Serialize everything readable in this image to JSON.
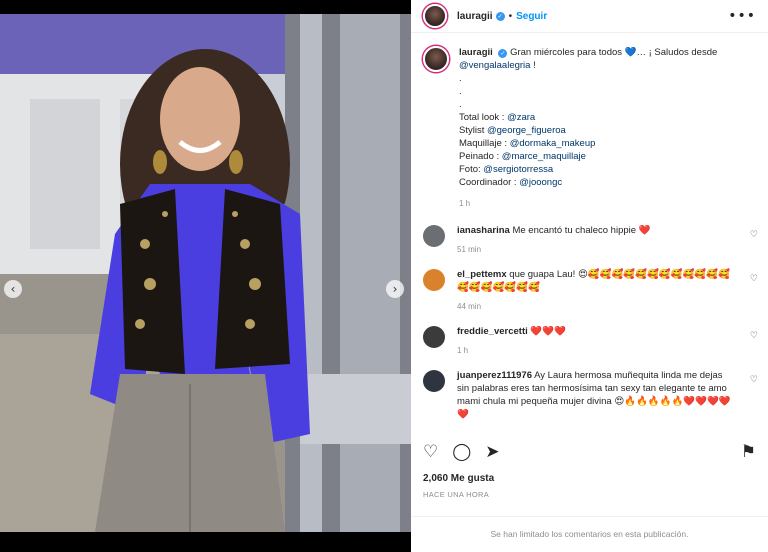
{
  "media": {
    "nav_prev_glyph": "‹",
    "nav_next_glyph": "›",
    "slide_count": 5,
    "active_slide": 3
  },
  "header": {
    "username": "lauragii",
    "verified_glyph": "✓",
    "separator": "•",
    "follow_label": "Seguir",
    "more_glyph": "•••"
  },
  "caption": {
    "username": "lauragii",
    "verified_glyph": "✓",
    "text_before_mention": "Gran miércoles para todos 💙… ¡ Saludos desde",
    "mention_main": "@vengalaalegria",
    "text_after_mention": " !",
    "dot_lines": [
      ".",
      ".",
      "."
    ],
    "credits": [
      {
        "label": "Total look : ",
        "handle": "@zara"
      },
      {
        "label": "Stylist ",
        "handle": "@george_figueroa"
      },
      {
        "label": "Maquillaje : ",
        "handle": "@dormaka_makeup"
      },
      {
        "label": "Peinado : ",
        "handle": "@marce_maquillaje"
      },
      {
        "label": "Foto: ",
        "handle": "@sergiotorressa"
      },
      {
        "label": "Coordinador : ",
        "handle": "@jooongc"
      }
    ],
    "time": "1 h"
  },
  "comments": [
    {
      "username": "ianasharina",
      "text": "Me encantó tu chaleco hippie ❤️",
      "time": "51 min",
      "avatar_color": "#6b6f73"
    },
    {
      "username": "el_pettemx",
      "text": "que guapa Lau! 😍🥰🥰🥰🥰🥰🥰🥰🥰🥰🥰🥰🥰🥰🥰🥰🥰🥰🥰🥰",
      "time": "44 min",
      "avatar_color": "#d9822b"
    },
    {
      "username": "freddie_vercetti",
      "text": "❤️❤️❤️",
      "time": "1 h",
      "avatar_color": "#3b3b3b"
    },
    {
      "username": "juanperez111976",
      "text": "Ay Laura hermosa muñequita linda me dejas sin palabras eres tan hermosísima tan sexy tan elegante te amo mami chula mi pequeña mujer divina 😍🔥🔥🔥🔥🔥❤️❤️❤️❤️❤️",
      "time": "",
      "avatar_color": "#2f3540"
    }
  ],
  "comment_like_glyph": "♡",
  "actions": {
    "like_glyph": "♡",
    "comment_glyph": "◯",
    "share_glyph": "➤",
    "save_glyph": "⚑"
  },
  "likes_text": "2,060 Me gusta",
  "post_time": "HACE UNA HORA",
  "limited_notice": "Se han limitado los comentarios en esta publicación.",
  "colors": {
    "link": "#00376b",
    "follow": "#0095f6",
    "muted": "#8e8e8e",
    "ring": "#d62976"
  }
}
